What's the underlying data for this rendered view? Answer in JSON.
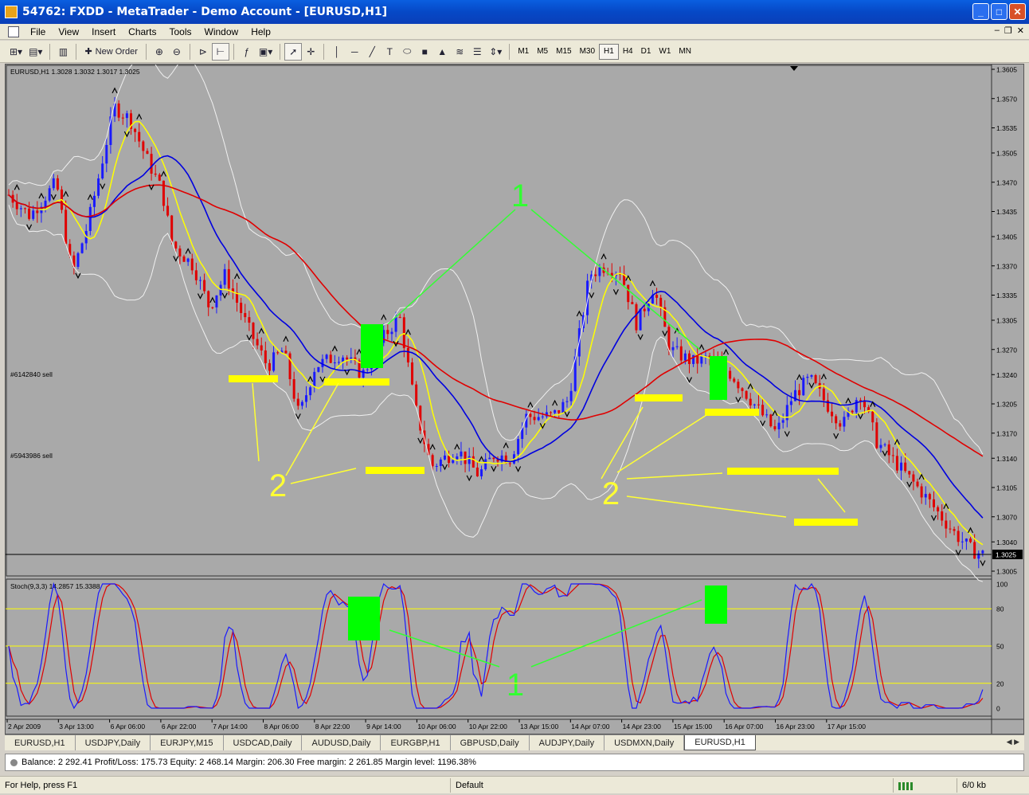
{
  "window": {
    "title": "54762: FXDD - MetaTrader - Demo Account - [EURUSD,H1]"
  },
  "menu": [
    "File",
    "View",
    "Insert",
    "Charts",
    "Tools",
    "Window",
    "Help"
  ],
  "toolbar": {
    "new_order_label": "New Order",
    "timeframes": [
      "M1",
      "M5",
      "M15",
      "M30",
      "H1",
      "H4",
      "D1",
      "W1",
      "MN"
    ],
    "active_timeframe": "H1"
  },
  "chart": {
    "info": "EURUSD,H1  1.3028 1.3032 1.3017 1.3025",
    "current_price": "1.3025",
    "order_labels": [
      "#6142840 sell",
      "#5943986 sell"
    ],
    "price_ticks": [
      "1.3605",
      "1.3570",
      "1.3535",
      "1.3505",
      "1.3470",
      "1.3435",
      "1.3405",
      "1.3370",
      "1.3335",
      "1.3305",
      "1.3270",
      "1.3240",
      "1.3205",
      "1.3170",
      "1.3140",
      "1.3105",
      "1.3070",
      "1.3040",
      "1.3005"
    ],
    "annotations": [
      "1",
      "2",
      "2",
      "1"
    ],
    "colors": {
      "background": "#a9a9a9",
      "bull_candle": "#1a1aff",
      "bear_candle": "#e00000",
      "ma_fast": "#ffff00",
      "ma_mid": "#0000e0",
      "ma_slow": "#e00000",
      "bands": "#f0f0f0",
      "highlight_green": "#00ff00",
      "highlight_yellow": "#ffff00",
      "annotation_green": "#33ff33",
      "annotation_yellow": "#ffff33"
    }
  },
  "stoch": {
    "label": "Stoch(9,3,3) 14.2857 15.3388",
    "levels": [
      "100",
      "80",
      "50",
      "20",
      "0"
    ]
  },
  "x_axis": [
    "2 Apr 2009",
    "3 Apr 13:00",
    "6 Apr 06:00",
    "6 Apr 22:00",
    "7 Apr 14:00",
    "8 Apr 06:00",
    "8 Apr 22:00",
    "9 Apr 14:00",
    "10 Apr 06:00",
    "10 Apr 22:00",
    "13 Apr 15:00",
    "14 Apr 07:00",
    "14 Apr 23:00",
    "15 Apr 15:00",
    "16 Apr 07:00",
    "16 Apr 23:00",
    "17 Apr 15:00"
  ],
  "tabs": [
    "EURUSD,H1",
    "USDJPY,Daily",
    "EURJPY,M15",
    "USDCAD,Daily",
    "AUDUSD,Daily",
    "EURGBP,H1",
    "GBPUSD,Daily",
    "AUDJPY,Daily",
    "USDMXN,Daily",
    "EURUSD,H1"
  ],
  "active_tab_index": 9,
  "terminal": {
    "text": "Balance: 2 292.41  Profit/Loss: 175.73  Equity: 2 468.14  Margin: 206.30  Free margin: 2 261.85  Margin level: 1196.38%"
  },
  "status": {
    "help": "For Help, press F1",
    "profile": "Default",
    "traffic": "6/0 kb"
  }
}
